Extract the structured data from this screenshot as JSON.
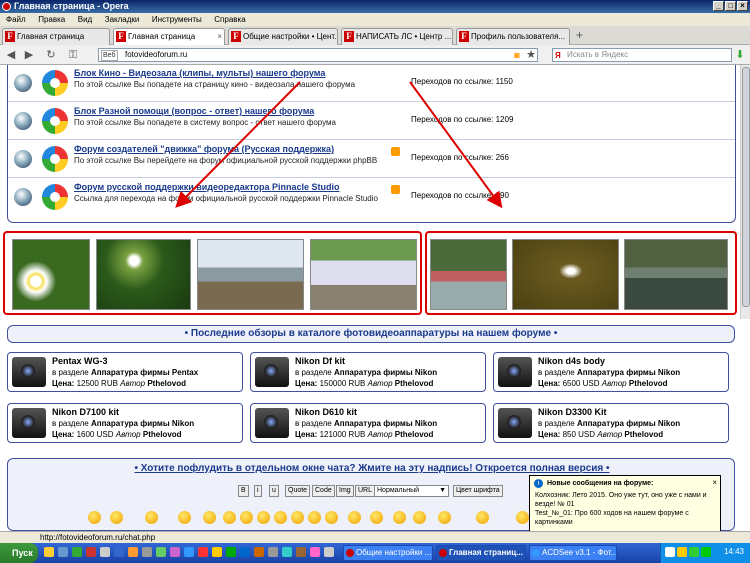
{
  "window": {
    "title": "Главная страница - Opera"
  },
  "menu": [
    "Файл",
    "Правка",
    "Вид",
    "Закладки",
    "Инструменты",
    "Справка"
  ],
  "tabs": [
    {
      "label": "Главная страница",
      "active": false
    },
    {
      "label": "Главная страница",
      "active": true
    },
    {
      "label": "Общие настройки • Цент...",
      "active": false
    },
    {
      "label": "НАПИСАТЬ ЛС • Центр ...",
      "active": false
    },
    {
      "label": "Профиль пользователя...",
      "active": false
    }
  ],
  "address": {
    "scheme_badge": "Веб",
    "url": "fotovideoforum.ru",
    "search_placeholder": "Искать в Яндекс"
  },
  "forums": [
    {
      "title": "Блок Кино - Видеозала (клипы, мульты) нашего форума",
      "desc": "По этой ссылке Вы попадете на страницу кино - видеозала нашего форума",
      "clicks": "Переходов по ссылке: 1150"
    },
    {
      "title": "Блок Разной помощи (вопрос - ответ) нашего форума",
      "desc": "По этой ссылке Вы попадете в систему вопрос - ответ нашего форума",
      "clicks": "Переходов по ссылке: 1209"
    },
    {
      "title": "Форум создателей \"движка\" форума (Русская поддержка)",
      "desc": "По этой ссылке Вы перейдете на форум официальной русской поддержки phpBB",
      "clicks": "Переходов по ссылке: 266"
    },
    {
      "title": "Форум русской поддержки видеоредактора Pinnacle Studio",
      "desc": "Ссылка для перехода на форум официальной русской поддержки Pinnacle Studio",
      "clicks": "Переходов по ссылке: 290"
    }
  ],
  "reviews": {
    "heading": "• Последние обзоры в каталоге фотовидеоаппаратуры на нашем форуме •",
    "items": [
      {
        "name": "Pentax WG-3",
        "section_prefix": "в разделе",
        "section": "Аппаратура фирмы Pentax",
        "price_label": "Цена:",
        "price": "12500 RUB",
        "author_label": "Автор",
        "author": "Pthelovod"
      },
      {
        "name": "Nikon Df kit",
        "section_prefix": "в разделе",
        "section": "Аппаратура фирмы Nikon",
        "price_label": "Цена:",
        "price": "150000 RUB",
        "author_label": "Автор",
        "author": "Pthelovod"
      },
      {
        "name": "Nikon d4s body",
        "section_prefix": "в разделе",
        "section": "Аппаратура фирмы Nikon",
        "price_label": "Цена:",
        "price": "6500 USD",
        "author_label": "Автор",
        "author": "Pthelovod"
      },
      {
        "name": "Nikon D7100 kit",
        "section_prefix": "в разделе",
        "section": "Аппаратура фирмы Nikon",
        "price_label": "Цена:",
        "price": "1600 USD",
        "author_label": "Автор",
        "author": "Pthelovod"
      },
      {
        "name": "Nikon D610 kit",
        "section_prefix": "в разделе",
        "section": "Аппаратура фирмы Nikon",
        "price_label": "Цена:",
        "price": "121000 RUB",
        "author_label": "Автор",
        "author": "Pthelovod"
      },
      {
        "name": "Nikon D3300 Kit",
        "section_prefix": "в разделе",
        "section": "Аппаратура фирмы Nikon",
        "price_label": "Цена:",
        "price": "850 USD",
        "author_label": "Автор",
        "author": "Pthelovod"
      }
    ]
  },
  "chat": {
    "heading": "• Хотите пофлудить в отдельном окне чата? Жмите на эту надпись! Откроется полная версия •",
    "buttons": [
      "B",
      "i",
      "u",
      "Quote",
      "Code",
      "Img",
      "URL"
    ],
    "size_select": "Нормальный",
    "color_button": "Цвет шрифта"
  },
  "notification": {
    "title": "Новые сообщения на форуме:",
    "lines": [
      "Колхозник: Лето 2015. Оно уже тут, оно уже с нами и везде! № 01",
      "Test_№_01: Про 600 ходов на нашем форуме с картинками"
    ]
  },
  "statusbar": {
    "url": "http://fotovideoforum.ru/chat.php"
  },
  "taskbar": {
    "start": "Пуск",
    "tasks": [
      "Общие настройки ...",
      "Главная страниц...",
      "ACDSee v3.1 - Фот..."
    ],
    "clock": "14:43"
  },
  "colors": {
    "link": "#1a3a8c",
    "highlight_box": "#dd0000",
    "arrow": "#dd0000"
  }
}
